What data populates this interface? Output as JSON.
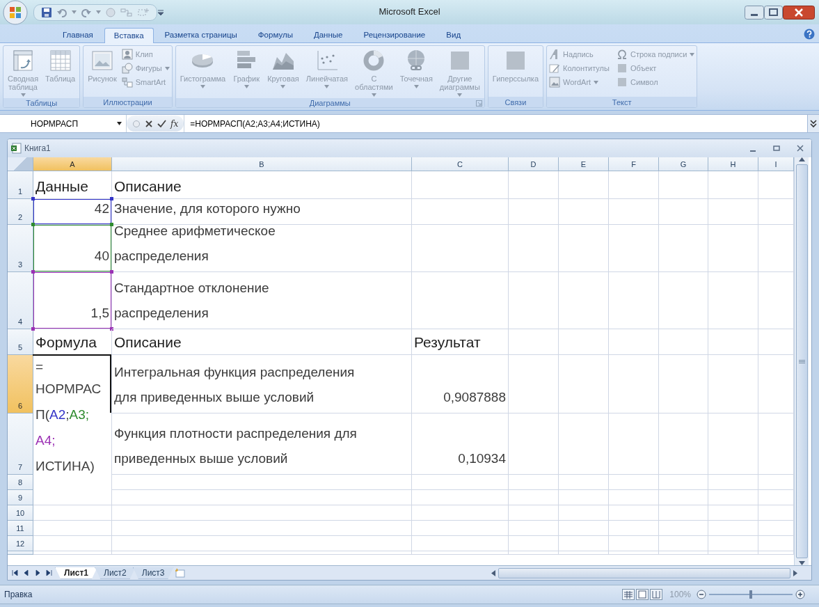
{
  "window": {
    "title": "Microsoft Excel"
  },
  "ribbon": {
    "tabs": [
      {
        "label": "Главная",
        "selected": false
      },
      {
        "label": "Вставка",
        "selected": true
      },
      {
        "label": "Разметка страницы",
        "selected": false
      },
      {
        "label": "Формулы",
        "selected": false
      },
      {
        "label": "Данные",
        "selected": false
      },
      {
        "label": "Рецензирование",
        "selected": false
      },
      {
        "label": "Вид",
        "selected": false
      }
    ],
    "groups": [
      {
        "title": "Таблицы",
        "buttons": [
          {
            "kind": "large",
            "label": "Сводная\nтаблица",
            "menu": true,
            "disabled": true
          },
          {
            "kind": "large",
            "label": "Таблица",
            "menu": false,
            "disabled": true
          }
        ]
      },
      {
        "title": "Иллюстрации",
        "buttons": [
          {
            "kind": "large",
            "label": "Рисунок",
            "menu": false,
            "disabled": true
          },
          {
            "kind": "small",
            "label": "Клип",
            "menu": false,
            "disabled": true
          },
          {
            "kind": "small",
            "label": "Фигуры",
            "menu": true,
            "disabled": true
          },
          {
            "kind": "small",
            "label": "SmartArt",
            "menu": false,
            "disabled": true
          }
        ]
      },
      {
        "title": "Диаграммы",
        "buttons": [
          {
            "kind": "large",
            "label": "Гистограмма",
            "menu": true,
            "disabled": true
          },
          {
            "kind": "large",
            "label": "График",
            "menu": true,
            "disabled": true
          },
          {
            "kind": "large",
            "label": "Круговая",
            "menu": true,
            "disabled": true
          },
          {
            "kind": "large",
            "label": "Линейчатая",
            "menu": true,
            "disabled": true
          },
          {
            "kind": "large",
            "label": "С\nобластями",
            "menu": true,
            "disabled": true
          },
          {
            "kind": "large",
            "label": "Точечная",
            "menu": true,
            "disabled": true
          },
          {
            "kind": "large",
            "label": "Другие\nдиаграммы",
            "menu": true,
            "disabled": true
          }
        ]
      },
      {
        "title": "Связи",
        "buttons": [
          {
            "kind": "large",
            "label": "Гиперссылка",
            "menu": false,
            "disabled": true
          }
        ]
      },
      {
        "title": "Текст",
        "buttons": [
          {
            "kind": "small",
            "label": "Надпись",
            "menu": false,
            "disabled": true
          },
          {
            "kind": "small",
            "label": "Колонтитулы",
            "menu": false,
            "disabled": true
          },
          {
            "kind": "small",
            "label": "WordArt",
            "menu": true,
            "disabled": true
          },
          {
            "kind": "small",
            "label": "Строка подписи",
            "menu": true,
            "disabled": true
          },
          {
            "kind": "small",
            "label": "Объект",
            "menu": false,
            "disabled": true
          },
          {
            "kind": "small",
            "label": "Символ",
            "menu": false,
            "disabled": true
          }
        ]
      }
    ]
  },
  "formula_bar": {
    "name_box": "НОРМРАСП",
    "function_button": "fx",
    "formula": "=НОРМРАСП(A2;A3;A4;ИСТИНА)"
  },
  "workbook": {
    "title": "Книга1",
    "columns": [
      {
        "label": "A",
        "selected": true
      },
      {
        "label": "B",
        "selected": false
      },
      {
        "label": "C",
        "selected": false
      },
      {
        "label": "D",
        "selected": false
      },
      {
        "label": "E",
        "selected": false
      },
      {
        "label": "F",
        "selected": false
      },
      {
        "label": "G",
        "selected": false
      },
      {
        "label": "H",
        "selected": false
      },
      {
        "label": "I",
        "selected": false
      }
    ],
    "rows": [
      {
        "header": "1",
        "selected": false,
        "cells": [
          {
            "kind": "heading",
            "text": "Данные"
          },
          {
            "kind": "heading",
            "text": "Описание"
          }
        ]
      },
      {
        "header": "2",
        "selected": false,
        "cells": [
          {
            "kind": "number",
            "text": "42",
            "color": "#3434c8"
          },
          {
            "kind": "text",
            "text": "Значение, для которого нужно"
          }
        ]
      },
      {
        "header": "3",
        "selected": false,
        "cells": [
          {
            "kind": "number",
            "text": "40",
            "color": "#2e8b2e"
          },
          {
            "kind": "text",
            "text": "Среднее арифметическое\nраспределения"
          }
        ]
      },
      {
        "header": "4",
        "selected": false,
        "cells": [
          {
            "kind": "number",
            "text": "1,5",
            "color": "#9b30b4"
          },
          {
            "kind": "text",
            "text": "Стандартное отклонение\nраспределения"
          }
        ]
      },
      {
        "header": "5",
        "selected": false,
        "cells": [
          {
            "kind": "heading",
            "text": "Формула"
          },
          {
            "kind": "heading",
            "text": "Описание"
          },
          {
            "kind": "heading",
            "text": "Результат"
          }
        ]
      },
      {
        "header": "6",
        "selected": true,
        "cells": [
          {
            "kind": "formula",
            "selected": true,
            "lines": [
              [
                {
                  "text": "=",
                  "color": "#404040"
                }
              ],
              [
                {
                  "text": "НОРМРАС",
                  "color": "#404040"
                }
              ],
              [
                {
                  "text": "П(",
                  "color": "#404040"
                },
                {
                  "text": "A2",
                  "color": "#3434c8"
                },
                {
                  "text": ";",
                  "color": "#404040"
                },
                {
                  "text": "A3;",
                  "color": "#2e8b2e"
                }
              ],
              [
                {
                  "text": "A4;",
                  "color": "#9b30b4"
                }
              ],
              [
                {
                  "text": "ИСТИНА)",
                  "color": "#404040"
                }
              ]
            ]
          },
          {
            "kind": "text",
            "text": "Интегральная функция распределения\nдля приведенных выше условий"
          },
          {
            "kind": "number",
            "text": "0,9087888"
          }
        ]
      },
      {
        "header": "7",
        "selected": false,
        "cells": [
          {
            "kind": "covered"
          },
          {
            "kind": "text",
            "text": "Функция плотности распределения для\nприведенных выше условий"
          },
          {
            "kind": "number",
            "text": "0,10934"
          }
        ]
      },
      {
        "header": "8",
        "selected": false,
        "cells": [
          {
            "kind": "covered"
          }
        ]
      },
      {
        "header": "9",
        "selected": false
      },
      {
        "header": "10",
        "selected": false
      },
      {
        "header": "11",
        "selected": false
      },
      {
        "header": "12",
        "selected": false
      }
    ],
    "sheet_tabs": [
      {
        "label": "Лист1",
        "selected": true
      },
      {
        "label": "Лист2",
        "selected": false
      },
      {
        "label": "Лист3",
        "selected": false
      }
    ]
  },
  "status_bar": {
    "mode": "Правка",
    "zoom": {
      "label": "100%",
      "level": 0.5
    }
  }
}
